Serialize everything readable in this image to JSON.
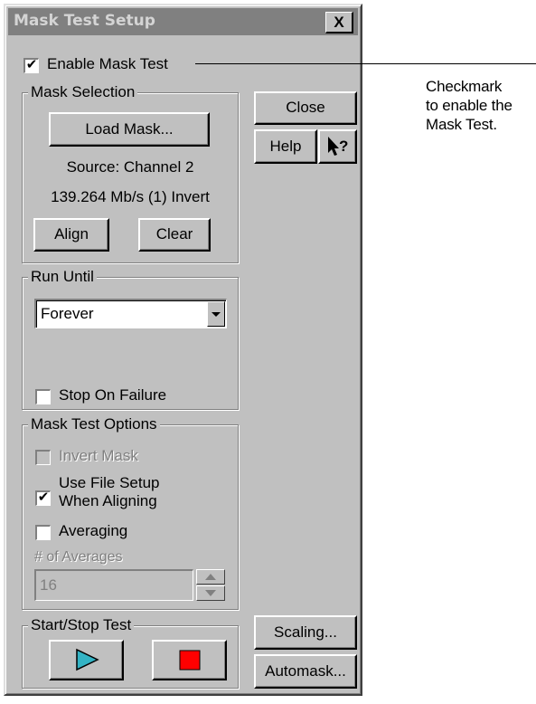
{
  "window": {
    "title": "Mask Test Setup",
    "close_glyph": "X"
  },
  "enable": {
    "label": "Enable Mask Test",
    "checked": true
  },
  "callout": {
    "text": "Checkmark\nto enable the\nMask Test."
  },
  "mask_selection": {
    "title": "Mask Selection",
    "load_label": "Load Mask...",
    "source": "Source: Channel 2",
    "rate": "139.264 Mb/s (1) Invert",
    "align_label": "Align",
    "clear_label": "Clear"
  },
  "side_buttons": {
    "close": "Close",
    "help": "Help",
    "whats_this_glyph": "?"
  },
  "run_until": {
    "title": "Run Until",
    "selected": "Forever",
    "stop_on_failure": {
      "label": "Stop On Failure",
      "checked": false
    }
  },
  "options": {
    "title": "Mask Test Options",
    "invert_mask": {
      "label": "Invert Mask",
      "checked": false,
      "disabled": true
    },
    "use_file_setup": {
      "label_line1": "Use File Setup",
      "label_line2": "When Aligning",
      "checked": true
    },
    "averaging": {
      "label": "Averaging",
      "checked": false
    },
    "num_averages_label": "# of Averages",
    "num_averages_value": "16"
  },
  "start_stop": {
    "title": "Start/Stop Test",
    "start_color": "#33b3c4",
    "stop_color": "#ff0000"
  },
  "bottom_buttons": {
    "scaling": "Scaling...",
    "automask": "Automask..."
  }
}
